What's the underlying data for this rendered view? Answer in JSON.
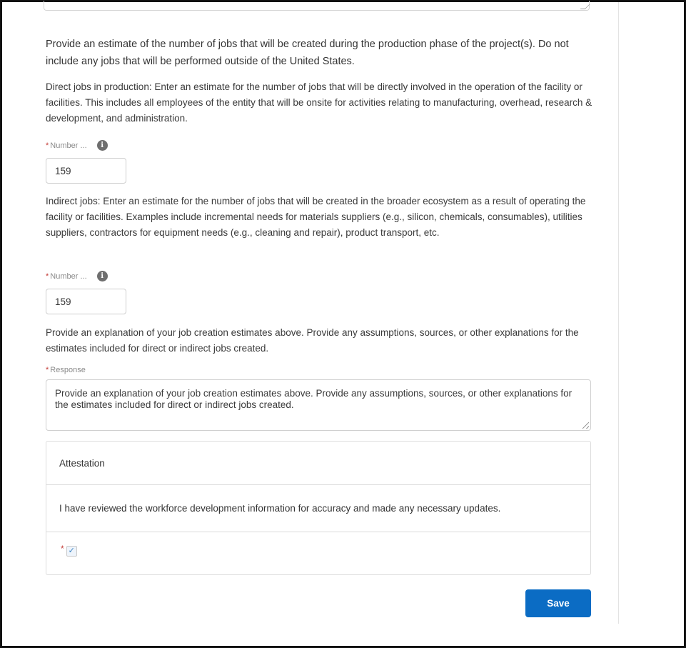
{
  "production": {
    "intro": "Provide an estimate of the number of jobs that will be created during the production phase of the project(s). Do not include any jobs that will be performed outside of the United States.",
    "direct_desc": "Direct jobs in production: Enter an estimate for the number of jobs that will be directly involved in the operation of the facility or facilities. This includes all employees of the entity that will be onsite for activities relating to manufacturing, overhead, research & development, and administration.",
    "direct_label": "Number ...",
    "direct_value": "159",
    "indirect_desc": "Indirect jobs: Enter an estimate for the number of jobs that will be created in the broader ecosystem as a result of operating the facility or facilities. Examples include incremental needs for materials suppliers (e.g., silicon, chemicals, consumables), utilities suppliers, contractors for equipment needs (e.g., cleaning and repair), product transport, etc.",
    "indirect_label": "Number ...",
    "indirect_value": "159",
    "explanation_prompt": "Provide an explanation of your job creation estimates above. Provide any assumptions, sources, or other explanations for the estimates included for direct or indirect jobs created.",
    "response_label": "Response",
    "response_value": "Provide an explanation of your job creation estimates above. Provide any assumptions, sources, or other explanations for the estimates included for direct or indirect jobs created."
  },
  "attestation": {
    "title": "Attestation",
    "statement": "I have reviewed the workforce development information for accuracy and made any necessary updates.",
    "checked": true
  },
  "required_marker": "*",
  "info_glyph": "i",
  "check_glyph": "✓",
  "save_label": "Save",
  "colors": {
    "primary_button": "#0b6cc4",
    "required": "#c23934"
  }
}
